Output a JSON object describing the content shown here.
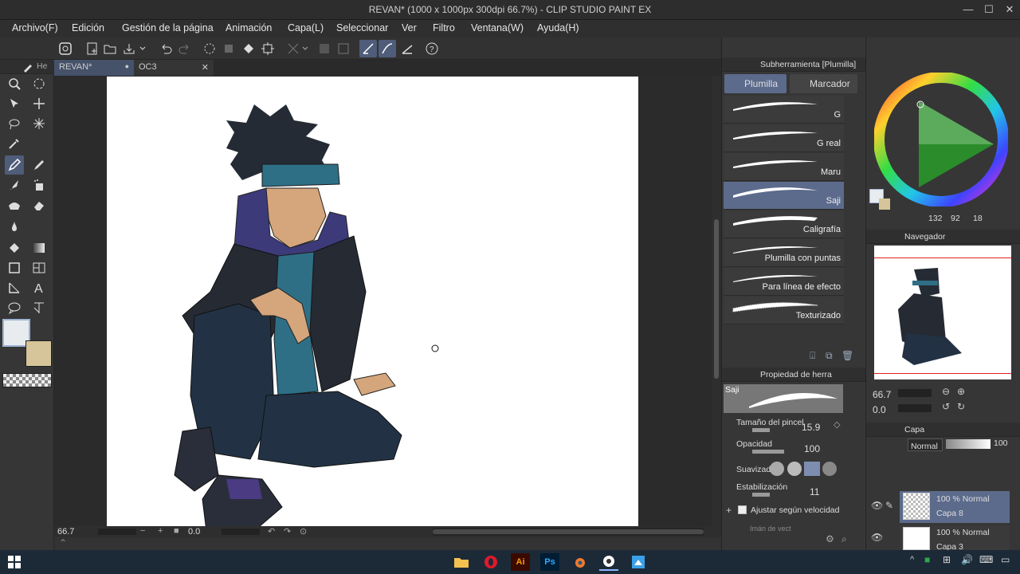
{
  "window": {
    "title": "REVAN* (1000 x 1000px 300dpi 66.7%)  - CLIP STUDIO PAINT EX",
    "minimize": "—",
    "maximize": "☐",
    "close": "✕"
  },
  "menu": [
    "Archivo(F)",
    "Edición",
    "Gestión de la página",
    "Animación",
    "Capa(L)",
    "Seleccionar",
    "Ver",
    "Filtro",
    "Ventana(W)",
    "Ayuda(H)"
  ],
  "tool_panel": {
    "header": "He"
  },
  "tabs": [
    {
      "label": "REVAN*",
      "marker": "●"
    },
    {
      "label": "OC3",
      "marker": "✕"
    }
  ],
  "status": {
    "zoom": "66.7",
    "rotation": "0.0"
  },
  "subtool_panel": {
    "title": "Subherramienta [Plumilla]",
    "tab_active": "Plumilla",
    "tab_other": "Marcador",
    "brushes": [
      "G",
      "G real",
      "Maru",
      "Saji",
      "Caligrafía",
      "Plumilla con puntas",
      "Para línea de efecto",
      "Texturizado"
    ],
    "selected_brush": "Saji"
  },
  "tool_property": {
    "title": "Propiedad de herra",
    "preview_label": "Saji",
    "brush_size_label": "Tamaño del pincel",
    "brush_size_value": "15.9",
    "opacity_label": "Opacidad",
    "opacity_value": "100",
    "smoothing_label": "Suavizado",
    "stabilization_label": "Estabilización",
    "stabilization_value": "11",
    "adjust_speed_label": "Ajustar según velocidad",
    "magnet_label": "Imán de vect"
  },
  "color": {
    "h": "132",
    "s": "92",
    "v": "18",
    "main_color": "#e8ecef",
    "sub_color": "#d6c59a"
  },
  "navigator": {
    "title": "Navegador",
    "zoom": "66.7",
    "rotation": "0.0"
  },
  "layers": {
    "title": "Capa",
    "blend_mode": "Normal",
    "opacity": "100",
    "items": [
      {
        "mode": "100 % Normal",
        "name": "Capa 8"
      },
      {
        "mode": "100 % Normal",
        "name": "Capa 3"
      }
    ]
  },
  "taskbar": {
    "apps": [
      "file-explorer",
      "opera",
      "illustrator",
      "photoshop",
      "blender",
      "clip-studio",
      "paint-app"
    ],
    "ai_label": "Ai",
    "ps_label": "Ps"
  }
}
